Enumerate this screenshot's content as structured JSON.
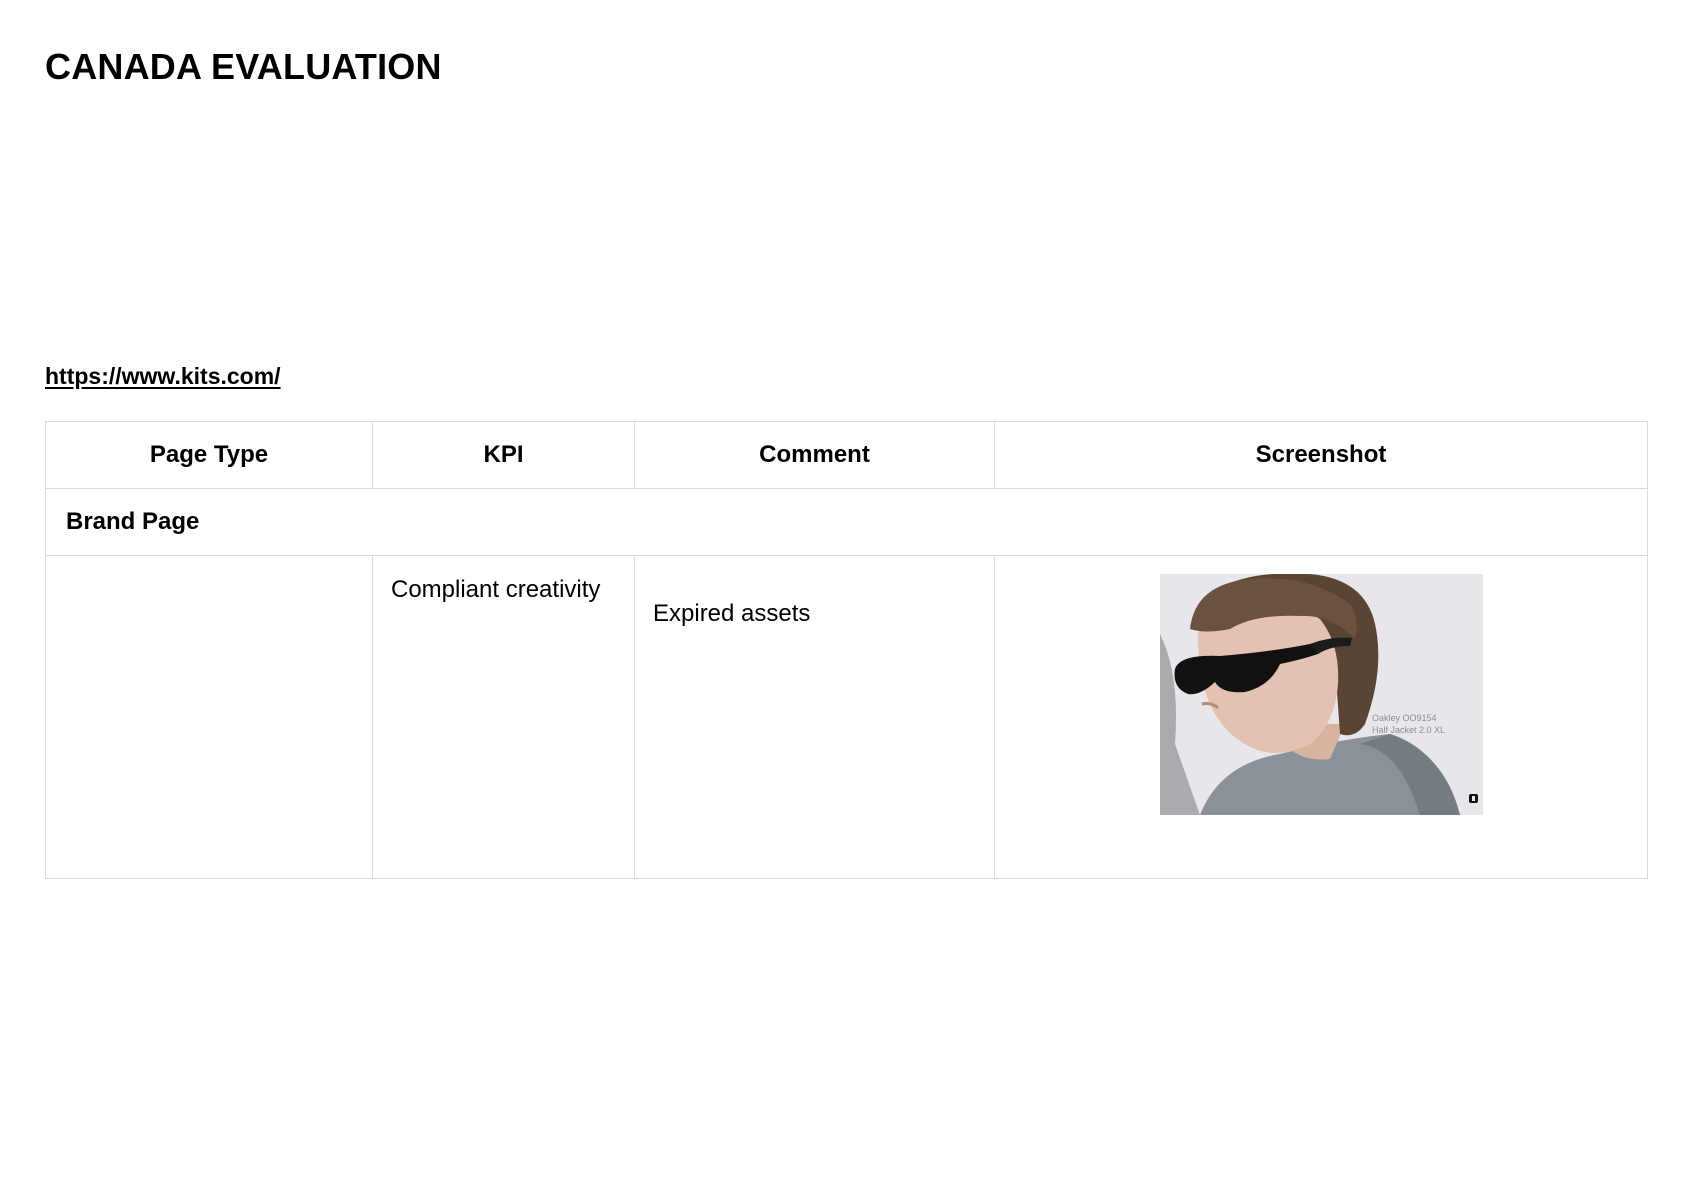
{
  "title": "CANADA EVALUATION",
  "link": "https://www.kits.com/",
  "table": {
    "headers": [
      "Page Type",
      "KPI",
      "Comment",
      "Screenshot"
    ],
    "section": "Brand Page",
    "rows": [
      {
        "page_type": "",
        "kpi": "Compliant creativity",
        "comment": "Expired assets",
        "screenshot": {
          "caption_line1": "Oakley OO9154",
          "caption_line2": "Half Jacket 2.0 XL"
        }
      }
    ]
  },
  "colors": {
    "border": "#dadada",
    "photo_background": "#e8e6ea",
    "jacket": "#8a9198",
    "hair": "#5a4433"
  }
}
